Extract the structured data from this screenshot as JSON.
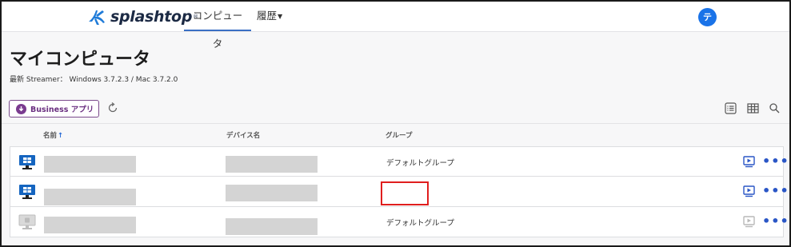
{
  "nav": {
    "brand": "splashtop",
    "reg": "®",
    "tabs": [
      {
        "label": "コンピュータ",
        "active": true
      },
      {
        "label": "履歴",
        "dropdown": true
      }
    ],
    "avatar_initial": "テ",
    "avatar_color": "#1a73e8"
  },
  "page": {
    "title": "マイコンピュータ",
    "streamer_info": "最新 Streamer： Windows 3.7.2.3 / Mac 3.7.2.0"
  },
  "toolbar": {
    "business_app_label": "Business アプリ",
    "business_app_icon": "download-circle-icon",
    "refresh_icon": "refresh-icon",
    "view_icons": [
      "list-view-icon",
      "grid-view-icon",
      "search-icon"
    ],
    "accent": "#7b4b8c"
  },
  "table": {
    "columns": [
      {
        "label": "名前",
        "sort": "asc"
      },
      {
        "label": "デバイス名"
      },
      {
        "label": "グループ"
      }
    ],
    "rows": [
      {
        "status": "online",
        "os_icon": "windows-monitor-icon",
        "name": "",
        "device_name": "",
        "group": "デフォルトグループ"
      },
      {
        "status": "online",
        "os_icon": "windows-monitor-icon",
        "name": "",
        "device_name": "",
        "group": ""
      },
      {
        "status": "offline",
        "os_icon": "monitor-offline-icon",
        "name": "",
        "device_name": "",
        "group": "デフォルトグループ"
      }
    ]
  },
  "colors": {
    "primary": "#2a56c6",
    "highlight_box": "#e01e1e"
  }
}
